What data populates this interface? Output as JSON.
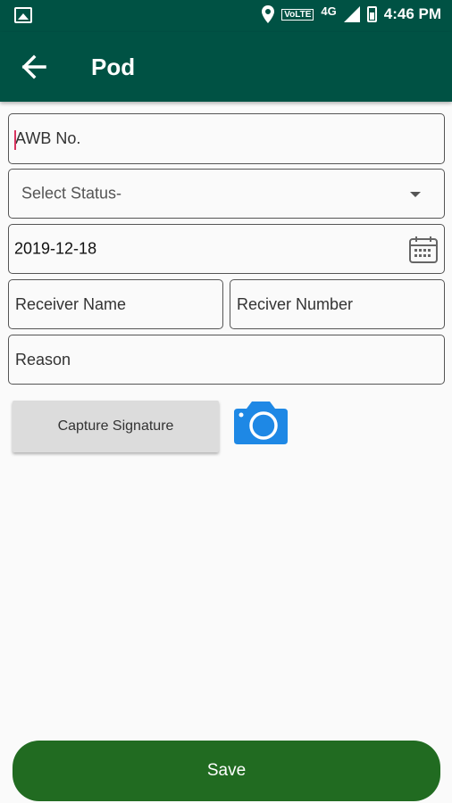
{
  "status_bar": {
    "time": "4:46 PM",
    "volte": "VoLTE",
    "network": "4G"
  },
  "app_bar": {
    "title": "Pod"
  },
  "form": {
    "awb_placeholder": "AWB No.",
    "status_selected": "Select Status-",
    "date_value": "2019-12-18",
    "receiver_name_placeholder": "Receiver Name",
    "receiver_number_placeholder": "Reciver Number",
    "reason_placeholder": "Reason"
  },
  "buttons": {
    "capture_signature": "Capture Signature",
    "save": "Save"
  },
  "icons": [
    "image-icon",
    "location-icon",
    "signal-icon",
    "battery-icon",
    "back-arrow-icon",
    "dropdown-arrow-icon",
    "calendar-icon",
    "camera-icon"
  ],
  "colors": {
    "app_bar": "#005244",
    "save_button": "#216b21",
    "camera": "#1e88e5",
    "caret": "#d8345f"
  }
}
